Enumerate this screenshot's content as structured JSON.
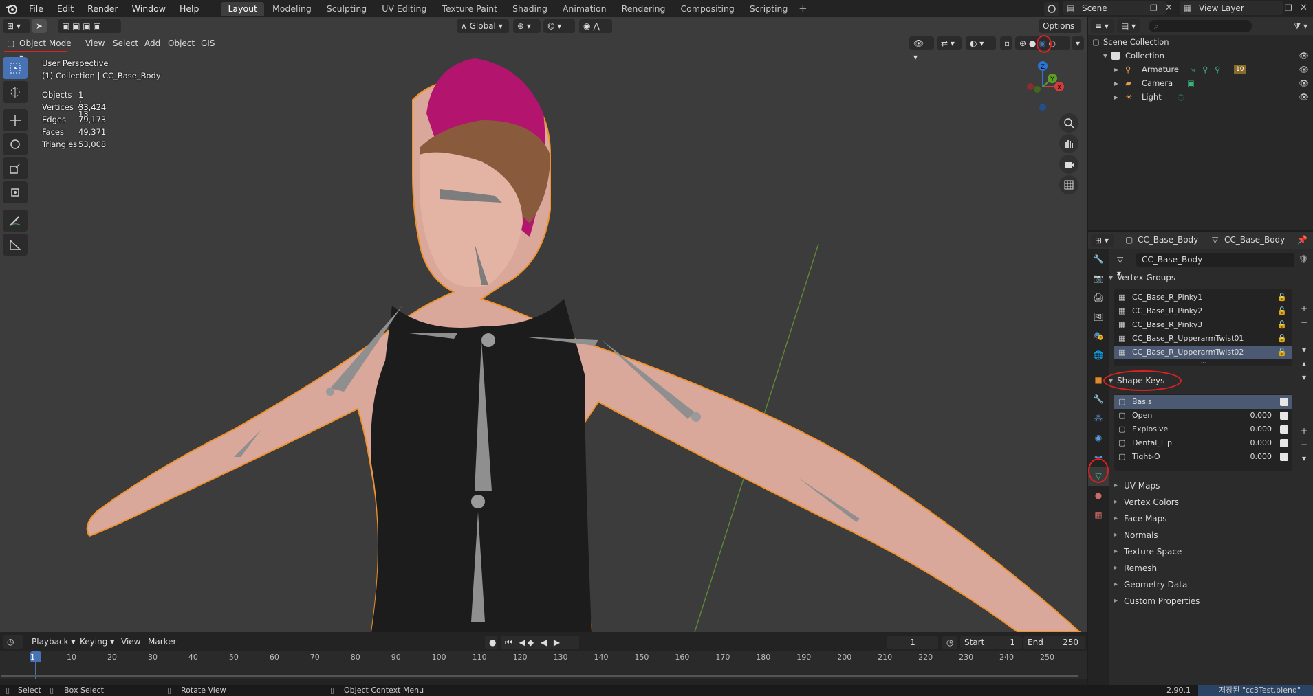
{
  "topbar": {
    "menus": [
      "File",
      "Edit",
      "Render",
      "Window",
      "Help"
    ],
    "tabs": [
      "Layout",
      "Modeling",
      "Sculpting",
      "UV Editing",
      "Texture Paint",
      "Shading",
      "Animation",
      "Rendering",
      "Compositing",
      "Scripting"
    ],
    "active_tab": "Layout",
    "add_tab": "+",
    "scene": "Scene",
    "view_layer": "View Layer"
  },
  "viewport": {
    "mode": "Object Mode",
    "menus": [
      "View",
      "Select",
      "Add",
      "Object",
      "GIS"
    ],
    "orientation": "Global",
    "options": "Options",
    "perspective": "User Perspective",
    "collection_info": "(1) Collection | CC_Base_Body",
    "stats": [
      {
        "label": "Objects",
        "value": "1 / 13"
      },
      {
        "label": "Vertices",
        "value": "33,424"
      },
      {
        "label": "Edges",
        "value": "79,173"
      },
      {
        "label": "Faces",
        "value": "49,371"
      },
      {
        "label": "Triangles",
        "value": "53,008"
      }
    ],
    "gizmo": {
      "z": "Z",
      "y": "Y",
      "x": "X"
    }
  },
  "timeline": {
    "menus": [
      "Playback",
      "Keying",
      "View",
      "Marker"
    ],
    "current_frame": "1",
    "start_label": "Start",
    "start": "1",
    "end_label": "End",
    "end": "250",
    "ticks": [
      "1",
      "10",
      "20",
      "30",
      "40",
      "50",
      "60",
      "70",
      "80",
      "90",
      "100",
      "110",
      "120",
      "130",
      "140",
      "150",
      "160",
      "170",
      "180",
      "190",
      "200",
      "210",
      "220",
      "230",
      "240",
      "250"
    ]
  },
  "statusbar": {
    "select": "Select",
    "box_select": "Box Select",
    "rotate_view": "Rotate View",
    "context_menu": "Object Context Menu",
    "version": "2.90.1",
    "file": "저장된 \"cc3Test.blend\""
  },
  "outliner": {
    "root": "Scene Collection",
    "collection": "Collection",
    "items": [
      "Armature",
      "Camera",
      "Light"
    ],
    "armature_badge": "10"
  },
  "properties": {
    "object_name": "CC_Base_Body",
    "mesh_name": "CC_Base_Body",
    "data_name": "CC_Base_Body",
    "vertex_groups_title": "Vertex Groups",
    "vertex_groups": [
      "CC_Base_R_Pinky1",
      "CC_Base_R_Pinky2",
      "CC_Base_R_Pinky3",
      "CC_Base_R_UpperarmTwist01",
      "CC_Base_R_UpperarmTwist02"
    ],
    "shape_keys_title": "Shape Keys",
    "shape_keys": [
      {
        "name": "Basis",
        "value": ""
      },
      {
        "name": "Open",
        "value": "0.000"
      },
      {
        "name": "Explosive",
        "value": "0.000"
      },
      {
        "name": "Dental_Lip",
        "value": "0.000"
      },
      {
        "name": "Tight-O",
        "value": "0.000"
      }
    ],
    "collapsed_panels": [
      "UV Maps",
      "Vertex Colors",
      "Face Maps",
      "Normals",
      "Texture Space",
      "Remesh",
      "Geometry Data",
      "Custom Properties"
    ]
  },
  "colors": {
    "accent": "#4772b3",
    "selection_outline": "#f0922b",
    "annotation": "#e02020",
    "mesh_active": "#34c295"
  }
}
